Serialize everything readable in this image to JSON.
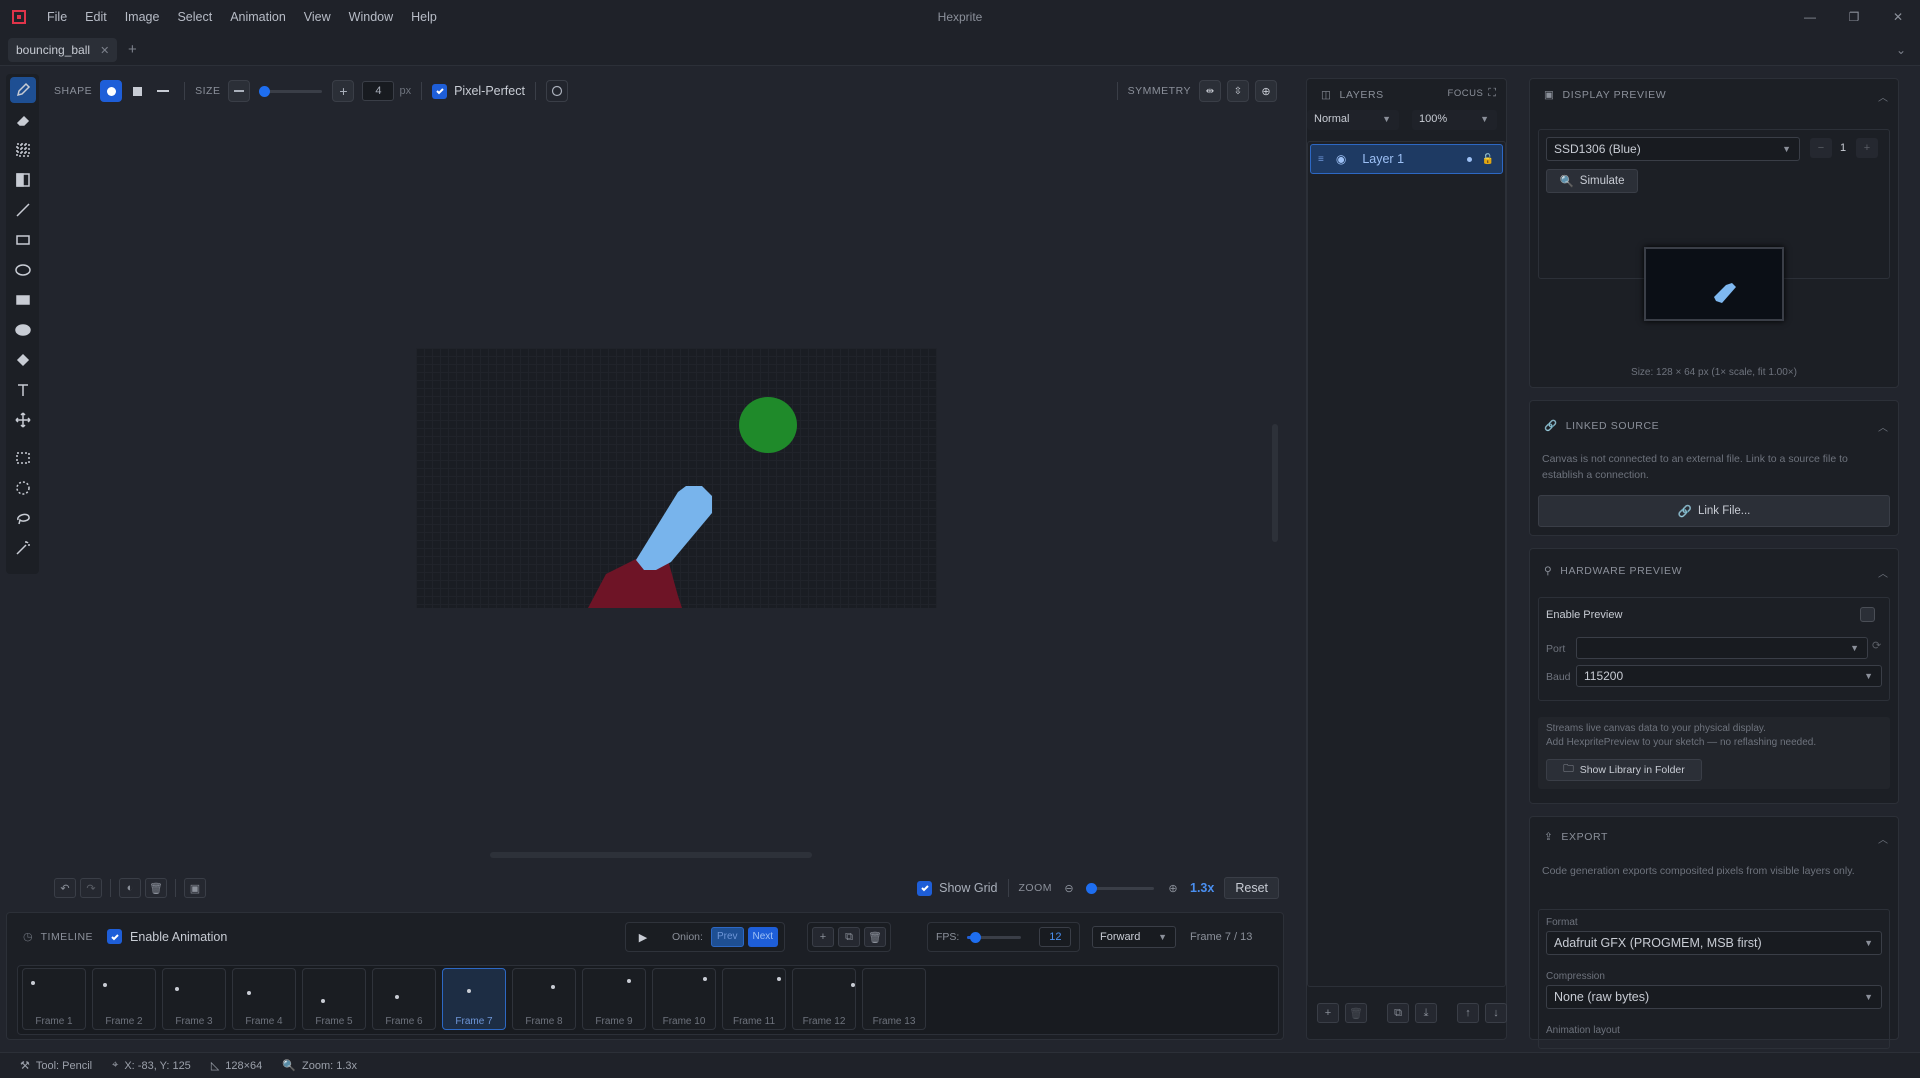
{
  "app": {
    "title": "Hexprite",
    "menu": [
      "File",
      "Edit",
      "Image",
      "Select",
      "Animation",
      "View",
      "Window",
      "Help"
    ],
    "brand_color": "#e0344a"
  },
  "tabs": [
    {
      "label": "bouncing_ball",
      "active": true
    }
  ],
  "toolbar": {
    "tools": [
      "pencil-icon",
      "eraser-icon",
      "dither-icon",
      "gradient-icon",
      "line-icon",
      "rectangle-icon",
      "ellipse-icon",
      "filled-rectangle-icon",
      "filled-ellipse-icon",
      "fill-bucket-icon",
      "text-icon",
      "move-icon",
      "rect-select-icon",
      "ellipse-select-icon",
      "lasso-icon",
      "magic-wand-icon"
    ],
    "active_tool": "pencil-icon"
  },
  "options": {
    "shape_label": "SHAPE",
    "size_label": "SIZE",
    "size_value": "4",
    "size_unit": "px",
    "size_fraction": 0.05,
    "pixel_perfect_label": "Pixel-Perfect",
    "pixel_perfect": true,
    "symmetry_label": "SYMMETRY"
  },
  "canvas_bar": {
    "show_grid_label": "Show Grid",
    "show_grid": true,
    "zoom_label": "ZOOM",
    "zoom_value": "1.3x",
    "zoom_fraction": 0.05,
    "reset_label": "Reset"
  },
  "timeline": {
    "title": "TIMELINE",
    "enable_label": "Enable Animation",
    "enabled": true,
    "onion_label": "Onion:",
    "prev_label": "Prev",
    "next_label": "Next",
    "fps_label": "FPS:",
    "fps_value": "12",
    "fps_fraction": 0.15,
    "direction": "Forward",
    "frame_counter": "Frame 7 / 13",
    "frames": [
      "Frame 1",
      "Frame 2",
      "Frame 3",
      "Frame 4",
      "Frame 5",
      "Frame 6",
      "Frame 7",
      "Frame 8",
      "Frame 9",
      "Frame 10",
      "Frame 11",
      "Frame 12",
      "Frame 13"
    ],
    "active_frame": 7
  },
  "layers": {
    "title": "LAYERS",
    "focus_label": "FOCUS",
    "blend_mode": "Normal",
    "opacity": "100%",
    "items": [
      {
        "name": "Layer 1"
      }
    ]
  },
  "display_preview": {
    "title": "DISPLAY PREVIEW",
    "device": "SSD1306 (Blue)",
    "count": "1",
    "simulate_label": "Simulate",
    "size_text": "Size: 128 × 64 px (1× scale, fit 1.00×)"
  },
  "linked_source": {
    "title": "LINKED SOURCE",
    "description": "Canvas is not connected to an external file. Link to a source file to establish a connection.",
    "link_button": "Link File..."
  },
  "hardware_preview": {
    "title": "HARDWARE PREVIEW",
    "enable_label": "Enable Preview",
    "port_label": "Port",
    "port_value": "",
    "baud_label": "Baud",
    "baud_value": "115200",
    "info_line1": "Streams live canvas data to your physical display.",
    "info_line2": "Add HexpritePreview to your sketch — no reflashing needed.",
    "library_button": "Show Library in Folder"
  },
  "export": {
    "title": "EXPORT",
    "description": "Code generation exports composited pixels from visible layers only.",
    "format_label": "Format",
    "format_value": "Adafruit GFX  (PROGMEM, MSB first)",
    "compression_label": "Compression",
    "compression_value": "None  (raw bytes)",
    "animation_layout_label": "Animation layout"
  },
  "status": {
    "tool": "Tool: Pencil",
    "coords": "X: -83, Y: 125",
    "canvas_size": "128×64",
    "zoom": "Zoom: 1.3x"
  },
  "colors": {
    "accent": "#1e5ed8",
    "green_ball": "#1f8a2a",
    "blue_stroke": "#78b4ec",
    "red_shape": "#6e1426"
  }
}
